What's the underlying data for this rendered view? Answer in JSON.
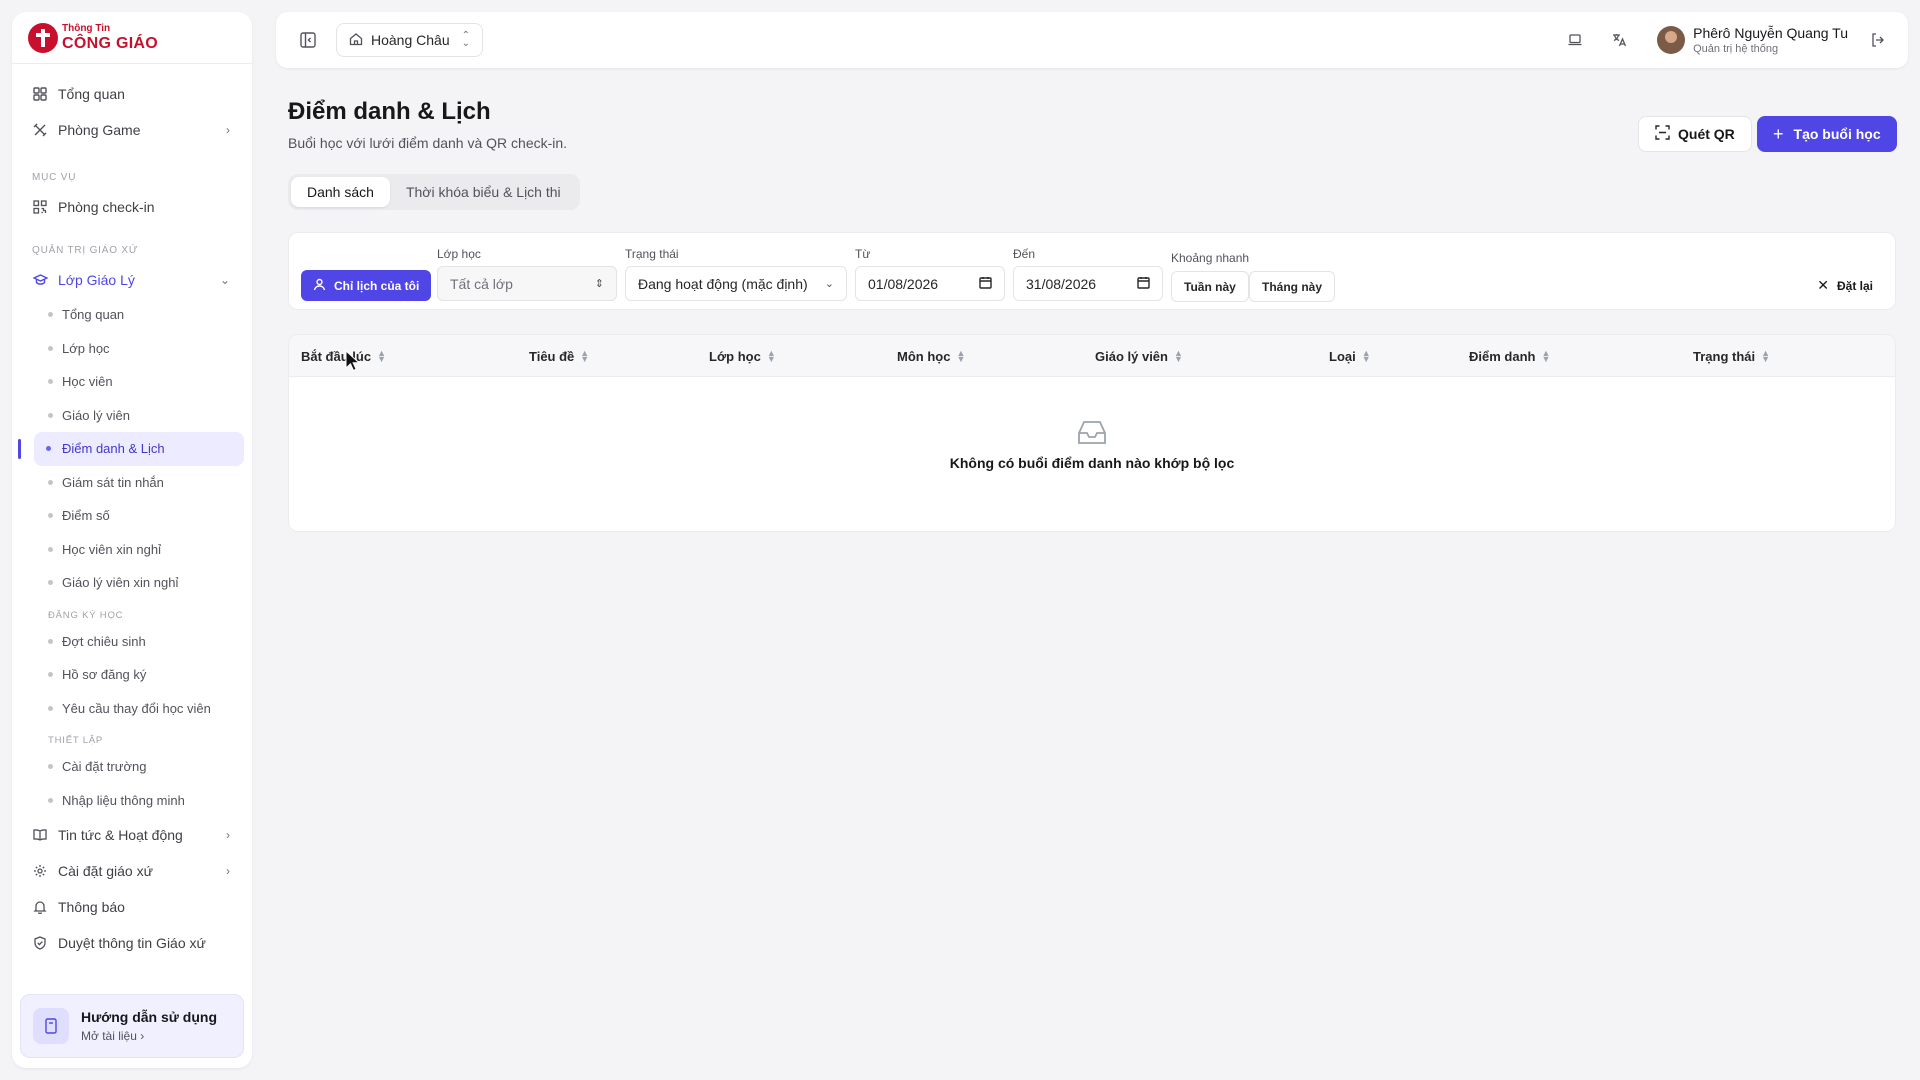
{
  "brand": {
    "line1": "Thông Tin",
    "line2": "CÔNG GIÁO",
    "color": "#c8102e"
  },
  "sidebar": {
    "top_items": [
      {
        "label": "Tổng quan",
        "icon": "dashboard-grid-icon"
      },
      {
        "label": "Phòng Game",
        "icon": "gamepad-icon"
      }
    ],
    "section_muc_vu": "MỤC VỤ",
    "checkin": {
      "label": "Phòng check-in",
      "icon": "qr-code-icon"
    },
    "section_quan_tri": "QUẢN TRỊ GIÁO XỨ",
    "lop_giao_ly": {
      "label": "Lớp Giáo Lý",
      "icon": "graduation-cap-icon"
    },
    "sub_items": [
      "Tổng quan",
      "Lớp học",
      "Học viên",
      "Giáo lý viên",
      "Điểm danh & Lịch",
      "Giám sát tin nhắn",
      "Điểm số",
      "Học viên xin nghỉ",
      "Giáo lý viên xin nghỉ"
    ],
    "sub_section_dang_ky": "ĐĂNG KÝ HỌC",
    "dang_ky_items": [
      "Đợt chiêu sinh",
      "Hồ sơ đăng ký",
      "Yêu cầu thay đổi học viên"
    ],
    "sub_section_thiet_lap": "THIẾT LẬP",
    "thiet_lap_items": [
      "Cài đặt trường",
      "Nhập liệu thông minh"
    ],
    "bottom_items": [
      {
        "label": "Tin tức & Hoạt động",
        "icon": "book-open-icon"
      },
      {
        "label": "Cài đặt giáo xứ",
        "icon": "gear-icon"
      },
      {
        "label": "Thông báo",
        "icon": "bell-icon"
      },
      {
        "label": "Duyệt thông tin Giáo xứ",
        "icon": "shield-check-icon"
      }
    ],
    "guide": {
      "title": "Hướng dẫn sử dụng",
      "subtitle": "Mở tài liệu"
    }
  },
  "topbar": {
    "parish": "Hoàng Châu",
    "user_name": "Phêrô Nguyễn Quang Tu",
    "user_role": "Quản trị hệ thống"
  },
  "page": {
    "title": "Điểm danh & Lịch",
    "subtitle": "Buổi học với lưới điểm danh và QR check-in.",
    "qr_button": "Quét QR",
    "create_button": "Tạo buổi học",
    "accent": "#4f46e5"
  },
  "tabs": [
    "Danh sách",
    "Thời khóa biểu & Lịch thi"
  ],
  "filters": {
    "mine_button": "Chỉ lịch của tôi",
    "class_label": "Lớp học",
    "class_value": "Tất cả lớp",
    "status_label": "Trạng thái",
    "status_value": "Đang hoạt động (mặc định)",
    "from_label": "Từ",
    "from_value": "01/08/2026",
    "to_label": "Đến",
    "to_value": "31/08/2026",
    "quick_label": "Khoảng nhanh",
    "quick_week": "Tuần này",
    "quick_month": "Tháng này",
    "reset": "Đặt lại"
  },
  "table": {
    "columns": [
      "Bắt đầu lúc",
      "Tiêu đề",
      "Lớp học",
      "Môn học",
      "Giáo lý viên",
      "Loại",
      "Điểm danh",
      "Trạng thái"
    ],
    "empty_text": "Không có buổi điểm danh nào khớp bộ lọc"
  }
}
